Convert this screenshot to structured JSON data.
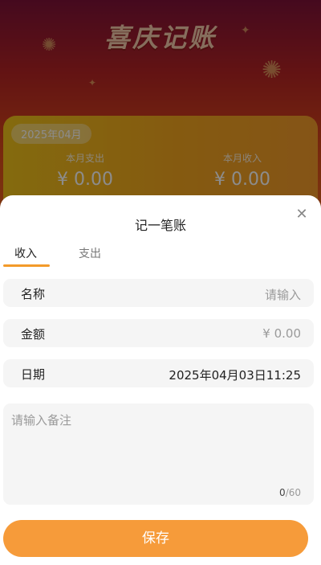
{
  "background": {
    "app_title": "喜庆记账",
    "summary_card": {
      "date_badge": "2025年04月",
      "expense": {
        "label": "本月支出",
        "value": "¥ 0.00"
      },
      "income": {
        "label": "本月收入",
        "value": "¥ 0.00"
      }
    }
  },
  "sheet": {
    "title": "记一笔账",
    "close_icon": "close-icon",
    "tabs": [
      {
        "label": "收入",
        "active": true
      },
      {
        "label": "支出",
        "active": false
      }
    ],
    "fields": {
      "name": {
        "label": "名称",
        "placeholder": "请输入"
      },
      "amount": {
        "label": "金额",
        "value": "¥ 0.00"
      },
      "date": {
        "label": "日期",
        "value": "2025年04月03日11:25"
      }
    },
    "note": {
      "placeholder": "请输入备注",
      "count": "0",
      "max": "/60"
    },
    "save_label": "保存"
  },
  "colors": {
    "accent": "#f39a2a",
    "save_button": "#f69b3a"
  }
}
